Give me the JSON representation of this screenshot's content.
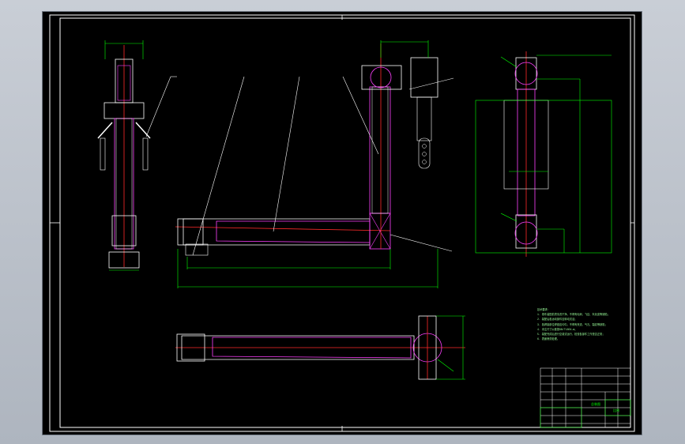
{
  "drawing": {
    "title_block": {
      "name_cell": "总装图",
      "scale_label": "比例"
    },
    "notes": {
      "heading": "技术要求：",
      "lines": [
        "1. 零件装配前须清洗干净，不得有毛刺、飞边、氧化皮等缺陷；",
        "2. 装配后各运动部件应转动灵活；",
        "3. 各焊接部位焊缝应均匀，不得有夹渣、气孔、裂纹等缺陷；",
        "4. 未注尺寸公差按GB/T1804-m；",
        "5. 装配完成后进行空载试运行，检查各部件工作是否正常；",
        "6. 表面喷漆处理。"
      ]
    },
    "colors": {
      "background": "#000000",
      "frame": "#ffffff",
      "centerline": "#ff2a2a",
      "outline": "#ff40ff",
      "dimension": "#00ff00",
      "text": "#9cff9c"
    }
  }
}
